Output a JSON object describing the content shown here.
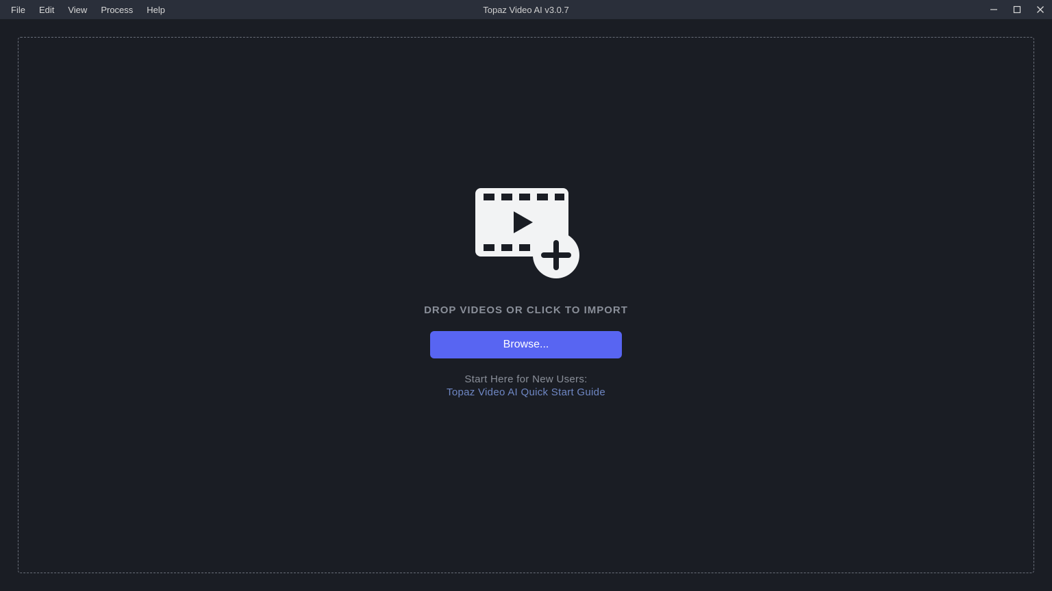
{
  "app": {
    "title": "Topaz Video AI  v3.0.7"
  },
  "menu": {
    "items": [
      "File",
      "Edit",
      "View",
      "Process",
      "Help"
    ]
  },
  "window_controls": {
    "minimize": "minimize",
    "maximize": "maximize",
    "close": "close"
  },
  "drop": {
    "instruction": "DROP VIDEOS OR CLICK TO IMPORT",
    "browse_label": "Browse...",
    "hint_label": "Start Here for New Users:",
    "hint_link_text": "Topaz Video AI Quick Start Guide"
  },
  "colors": {
    "accent": "#5865f2",
    "bg": "#1a1d24",
    "bar": "#2a2f3a",
    "muted": "#8a8f99",
    "link": "#6f87c4"
  }
}
